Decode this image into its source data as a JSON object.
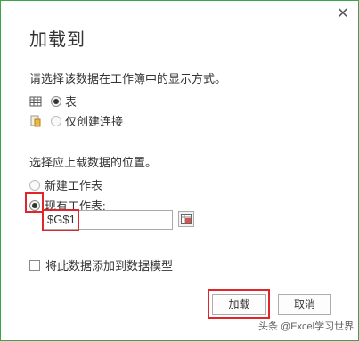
{
  "dialog": {
    "title": "加载到",
    "close_glyph": "✕"
  },
  "display_section": {
    "prompt": "请选择该数据在工作簿中的显示方式。",
    "options": [
      {
        "label": "表",
        "selected": true,
        "icon": "table-icon"
      },
      {
        "label": "仅创建连接",
        "selected": false,
        "disabled": true,
        "icon": "connection-icon"
      }
    ]
  },
  "location_section": {
    "prompt": "选择应上载数据的位置。",
    "options": [
      {
        "label": "新建工作表",
        "selected": false,
        "disabled": true
      },
      {
        "label": "现有工作表:",
        "selected": true
      }
    ],
    "cell_value": "$G$1",
    "ref_button_icon": "range-select-icon"
  },
  "data_model_checkbox": {
    "label": "将此数据添加到数据模型",
    "checked": false
  },
  "buttons": {
    "load_label": "加载",
    "cancel_label": "取消"
  },
  "watermark": "头条 @Excel学习世界",
  "highlight_color": "#e0262c",
  "border_color": "#3aa64a"
}
